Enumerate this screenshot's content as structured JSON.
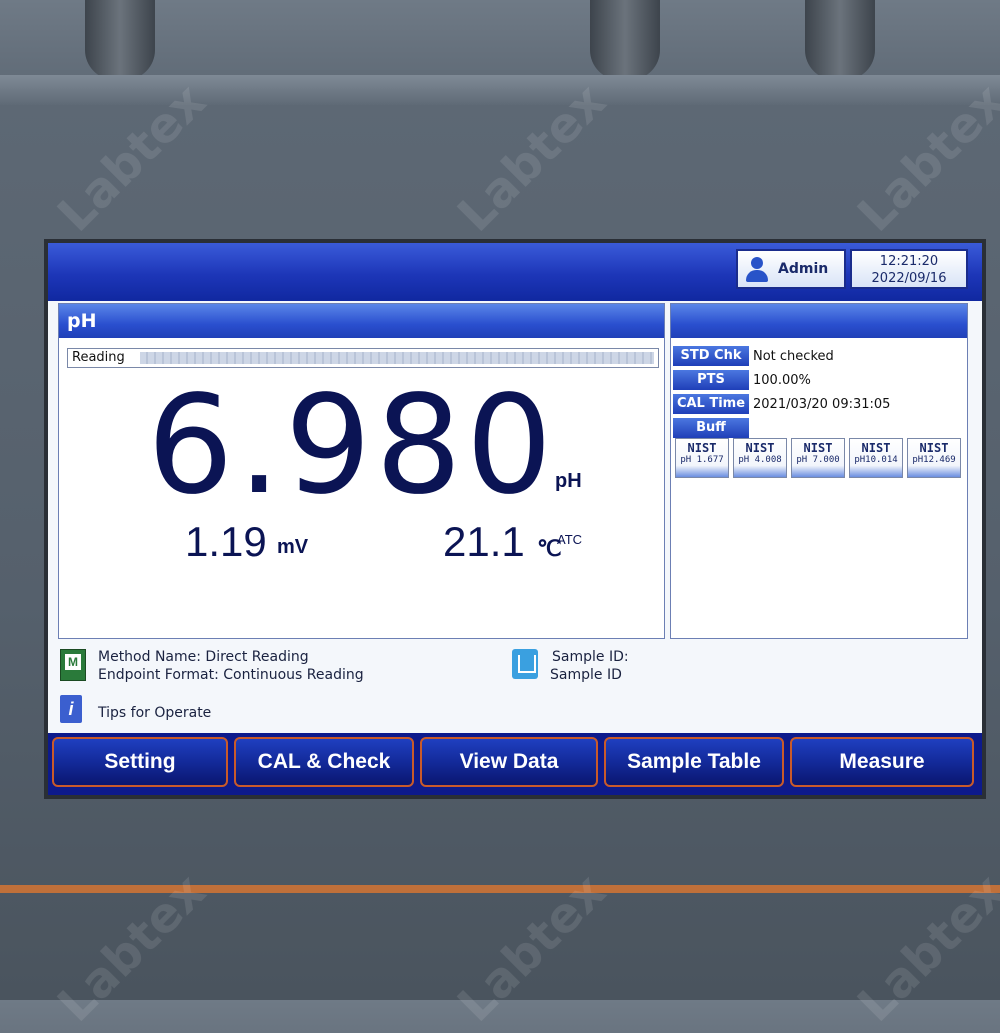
{
  "header": {
    "user": "Admin",
    "time": "12:21:20",
    "date": "2022/09/16"
  },
  "main": {
    "panel_title": "pH",
    "reading_label": "Reading",
    "value": "6.980",
    "value_unit": "pH",
    "mv_value": "1.19",
    "mv_unit": "mV",
    "temp_value": "21.1",
    "temp_unit": "℃",
    "temp_mode": "ATC"
  },
  "info": {
    "rows": [
      {
        "key": "STD Chk",
        "value": "Not checked"
      },
      {
        "key": "PTS",
        "value": "100.00%"
      },
      {
        "key": "CAL Time",
        "value": "2021/03/20  09:31:05"
      },
      {
        "key": "Buff",
        "value": ""
      }
    ],
    "buffers": [
      {
        "name": "NIST",
        "value": "pH 1.677"
      },
      {
        "name": "NIST",
        "value": "pH 4.008"
      },
      {
        "name": "NIST",
        "value": "pH 7.000"
      },
      {
        "name": "NIST",
        "value": "pH10.014"
      },
      {
        "name": "NIST",
        "value": "pH12.469"
      }
    ]
  },
  "status": {
    "method_name": "Method Name: Direct Reading",
    "endpoint_format": "Endpoint Format: Continuous Reading",
    "sample_id_label": "Sample ID:",
    "sample_id_value": "Sample ID",
    "tips": "Tips for Operate"
  },
  "nav": {
    "setting": "Setting",
    "cal_check": "CAL  &  Check",
    "view_data": "View  Data",
    "sample_table": "Sample  Table",
    "measure": "Measure"
  },
  "watermark": "Labtex",
  "colors": {
    "screen_blue": "#0d1a8c",
    "header_blue": "#2a4fcf",
    "value_navy": "#0b1454",
    "nav_border": "#c95a2a"
  }
}
